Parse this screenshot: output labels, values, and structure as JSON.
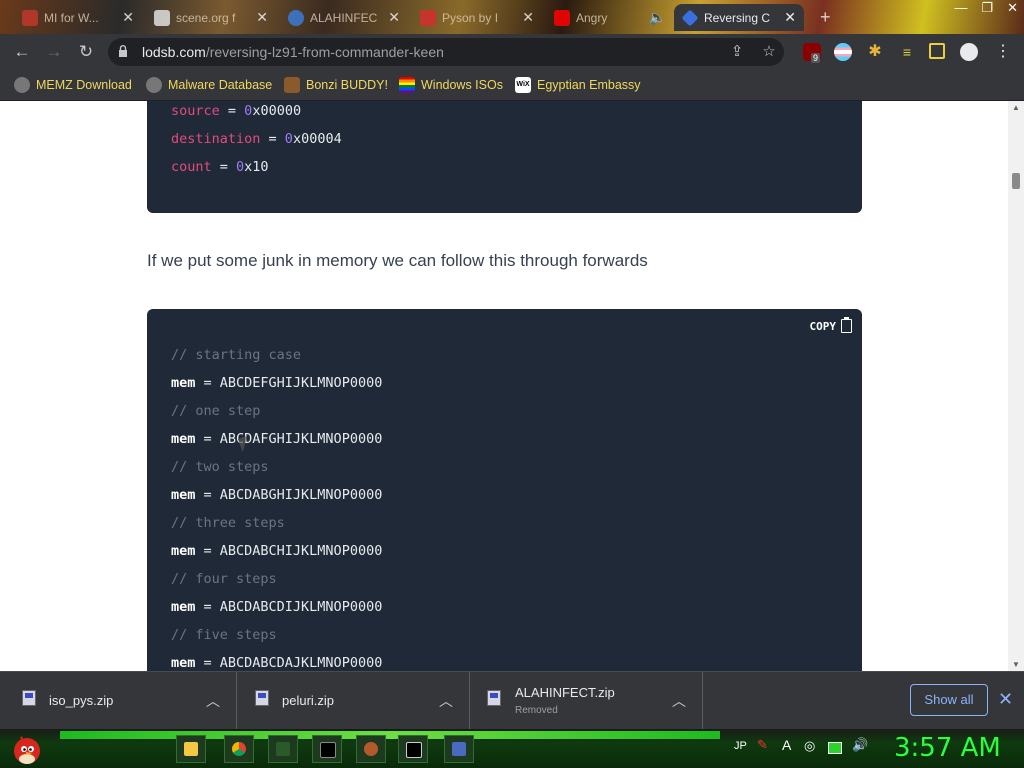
{
  "browser": {
    "tabs": [
      {
        "title": "MI for W..."
      },
      {
        "title": "scene.org f"
      },
      {
        "title": "ALAHINFEC"
      },
      {
        "title": "Pyson by I"
      },
      {
        "title": "Angry"
      },
      {
        "title": "Reversing C",
        "active": true
      }
    ],
    "url_host": "lodsb.com",
    "url_path": "/reversing-lz91-from-commander-keen",
    "extension_badge": "9"
  },
  "bookmarks": [
    {
      "label": "MEMZ Download"
    },
    {
      "label": "Malware Database"
    },
    {
      "label": "Bonzi BUDDY!"
    },
    {
      "label": "Windows ISOs"
    },
    {
      "label": "Egyptian Embassy"
    }
  ],
  "article": {
    "code_top": [
      {
        "key": "source",
        "eq": " = ",
        "num": "0",
        "rest": "x00000"
      },
      {
        "key": "destination",
        "eq": " = ",
        "num": "0",
        "rest": "x00004"
      },
      {
        "key": "count",
        "eq": " = ",
        "num": "0",
        "rest": "x10"
      }
    ],
    "paragraph": "If we put some junk in memory we can follow this through forwards",
    "copy_label": "COPY",
    "code_lines": [
      {
        "comment": "// starting case"
      },
      {
        "key": "mem",
        "value": " = ABCDEFGHIJKLMNOP0000"
      },
      {
        "comment": "// one step"
      },
      {
        "key": "mem",
        "value": " = ABCDAFGHIJKLMNOP0000"
      },
      {
        "comment": "// two steps"
      },
      {
        "key": "mem",
        "value": " = ABCDABGHIJKLMNOP0000"
      },
      {
        "comment": "// three steps"
      },
      {
        "key": "mem",
        "value": " = ABCDABCHIJKLMNOP0000"
      },
      {
        "comment": "// four steps"
      },
      {
        "key": "mem",
        "value": " = ABCDABCDIJKLMNOP0000"
      },
      {
        "comment": "// five steps"
      },
      {
        "key": "mem",
        "value": " = ABCDABCDAJKLMNOP0000"
      }
    ]
  },
  "downloads": {
    "items": [
      {
        "file": "iso_pys.zip",
        "status": ""
      },
      {
        "file": "peluri.zip",
        "status": ""
      },
      {
        "file": "ALAHINFECT.zip",
        "status": "Removed"
      }
    ],
    "show_all": "Show all"
  },
  "taskbar": {
    "lang": "JP",
    "ime": "A",
    "clock": "3:57 AM"
  },
  "colors": {
    "keyword": "#e34b7c",
    "number": "#9d7cf2",
    "comment": "#6b7483",
    "code_bg": "#1f2937",
    "clock": "#2bff3c"
  }
}
